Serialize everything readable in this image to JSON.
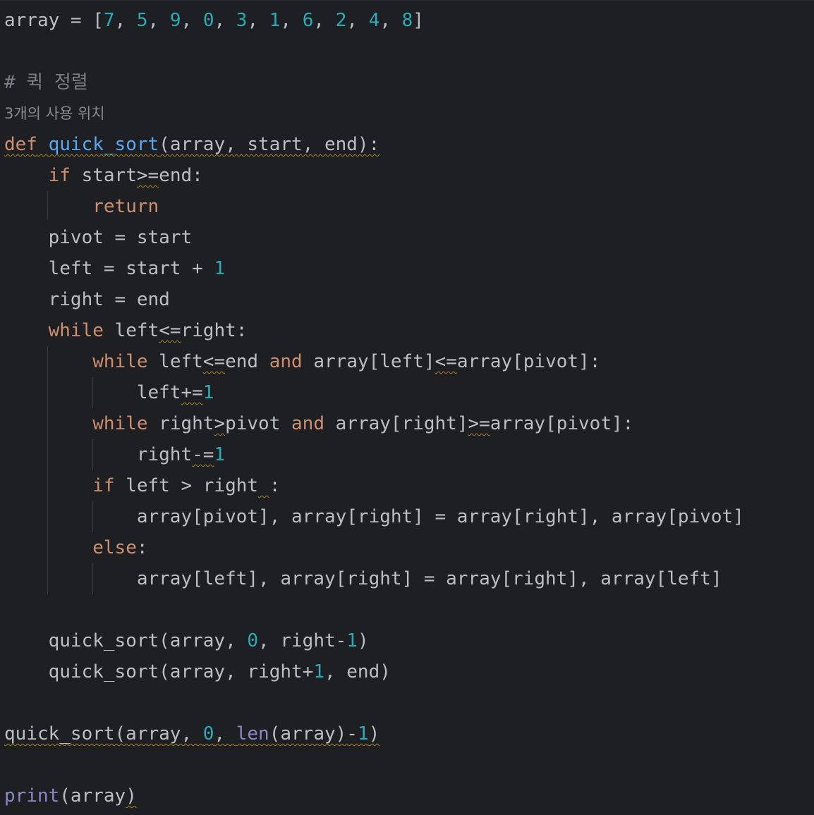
{
  "editor": {
    "language": "python",
    "theme": {
      "background": "#1e1f22",
      "keyword": "#cf8e6d",
      "number": "#2aacb8",
      "function_definition": "#56a8f5",
      "builtin": "#8888c6",
      "default_text": "#bcbec4",
      "comment": "#7a7e85",
      "warning_underline": "#a9822a"
    },
    "usage_hint": "3개의 사용 위치",
    "lines": [
      {
        "id": "l1",
        "tokens": [
          "array",
          " = [",
          "7",
          ", ",
          "5",
          ", ",
          "9",
          ", ",
          "0",
          ", ",
          "3",
          ", ",
          "1",
          ", ",
          "6",
          ", ",
          "2",
          ", ",
          "4",
          ", ",
          "8",
          "]"
        ]
      },
      {
        "id": "l3",
        "comment": "# 퀵 정렬"
      },
      {
        "id": "l5",
        "parts": {
          "kw_def": "def",
          "fn_name": "quick_sort",
          "params": "(array, start, end):"
        }
      },
      {
        "id": "l6",
        "parts": {
          "kw_if": "if",
          "cond_a": " start",
          "op": ">=",
          "cond_b": "end:"
        }
      },
      {
        "id": "l7",
        "parts": {
          "kw_return": "return"
        }
      },
      {
        "id": "l8",
        "text": "pivot = start"
      },
      {
        "id": "l9",
        "parts": {
          "a": "left = start + ",
          "n": "1"
        }
      },
      {
        "id": "l10",
        "text": "right = end"
      },
      {
        "id": "l11",
        "parts": {
          "kw_while": "while",
          "a": " left",
          "op": "<=",
          "b": "right:"
        }
      },
      {
        "id": "l12",
        "parts": {
          "kw_while": "while",
          "a": " left",
          "op1": "<=",
          "b": "end ",
          "kw_and": "and",
          "c": " array[left]",
          "op2": "<=",
          "d": "array[pivot]:"
        }
      },
      {
        "id": "l13",
        "parts": {
          "a": "left",
          "op": "+=",
          "n": "1"
        }
      },
      {
        "id": "l14",
        "parts": {
          "kw_while": "while",
          "a": " right",
          "op1": ">",
          "b": "pivot ",
          "kw_and": "and",
          "c": " array[right]",
          "op2": ">=",
          "d": "array[pivot]:"
        }
      },
      {
        "id": "l15",
        "parts": {
          "a": "right",
          "op": "-=",
          "n": "1"
        }
      },
      {
        "id": "l16",
        "parts": {
          "kw_if": "if",
          "a": " left > right",
          "gap": " ",
          "b": ":"
        }
      },
      {
        "id": "l17",
        "text": "array[pivot], array[right] = array[right], array[pivot]"
      },
      {
        "id": "l18",
        "parts": {
          "kw_else": "else",
          "b": ":"
        }
      },
      {
        "id": "l19",
        "text": "array[left], array[right] = array[right], array[left]"
      },
      {
        "id": "l21",
        "parts": {
          "a": "quick_sort(array, ",
          "n0": "0",
          "b": ", right-",
          "n1": "1",
          "c": ")"
        }
      },
      {
        "id": "l22",
        "parts": {
          "a": "quick_sort(array, right+",
          "n1": "1",
          "b": ", end)"
        }
      },
      {
        "id": "l24",
        "parts": {
          "a": "quick_sort(array, ",
          "n0": "0",
          "b": ", ",
          "len": "len",
          "c": "(array)-",
          "n1": "1",
          "d": ")"
        }
      },
      {
        "id": "l26",
        "parts": {
          "print": "print",
          "a": "(array",
          "b": ")"
        }
      }
    ]
  }
}
